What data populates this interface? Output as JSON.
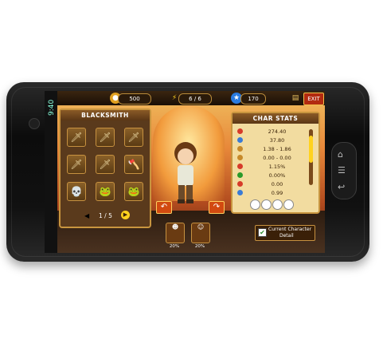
{
  "status": {
    "time": "9:40"
  },
  "hud": {
    "gold": "500",
    "energy": "6 / 6",
    "gems": "170",
    "exit_label": "EXIT"
  },
  "blacksmith": {
    "title": "BLACKSMITH",
    "page": "1 / 5",
    "slots": [
      "🗡",
      "🗡",
      "🗡",
      "🗡",
      "🗡",
      "🪓",
      "💀",
      "🐸",
      "🐸"
    ]
  },
  "stats": {
    "title": "CHAR STATS",
    "rows": [
      {
        "value": "274.40",
        "color": "#d63b2a"
      },
      {
        "value": "37.80",
        "color": "#3a7bd5"
      },
      {
        "value": "1.38 - 1.86",
        "color": "#c78a2a"
      },
      {
        "value": "0.00 - 0.00",
        "color": "#c78a2a"
      },
      {
        "value": "1.15%",
        "color": "#d63b2a"
      },
      {
        "value": "0.00%",
        "color": "#2a9a2a"
      },
      {
        "value": "0.00",
        "color": "#d63b2a"
      },
      {
        "value": "0.99",
        "color": "#3a7bd5"
      }
    ],
    "detail_label_1": "Current Character",
    "detail_label_2": "Detail"
  },
  "characters": [
    {
      "label": "20%"
    },
    {
      "label": "20%"
    }
  ]
}
